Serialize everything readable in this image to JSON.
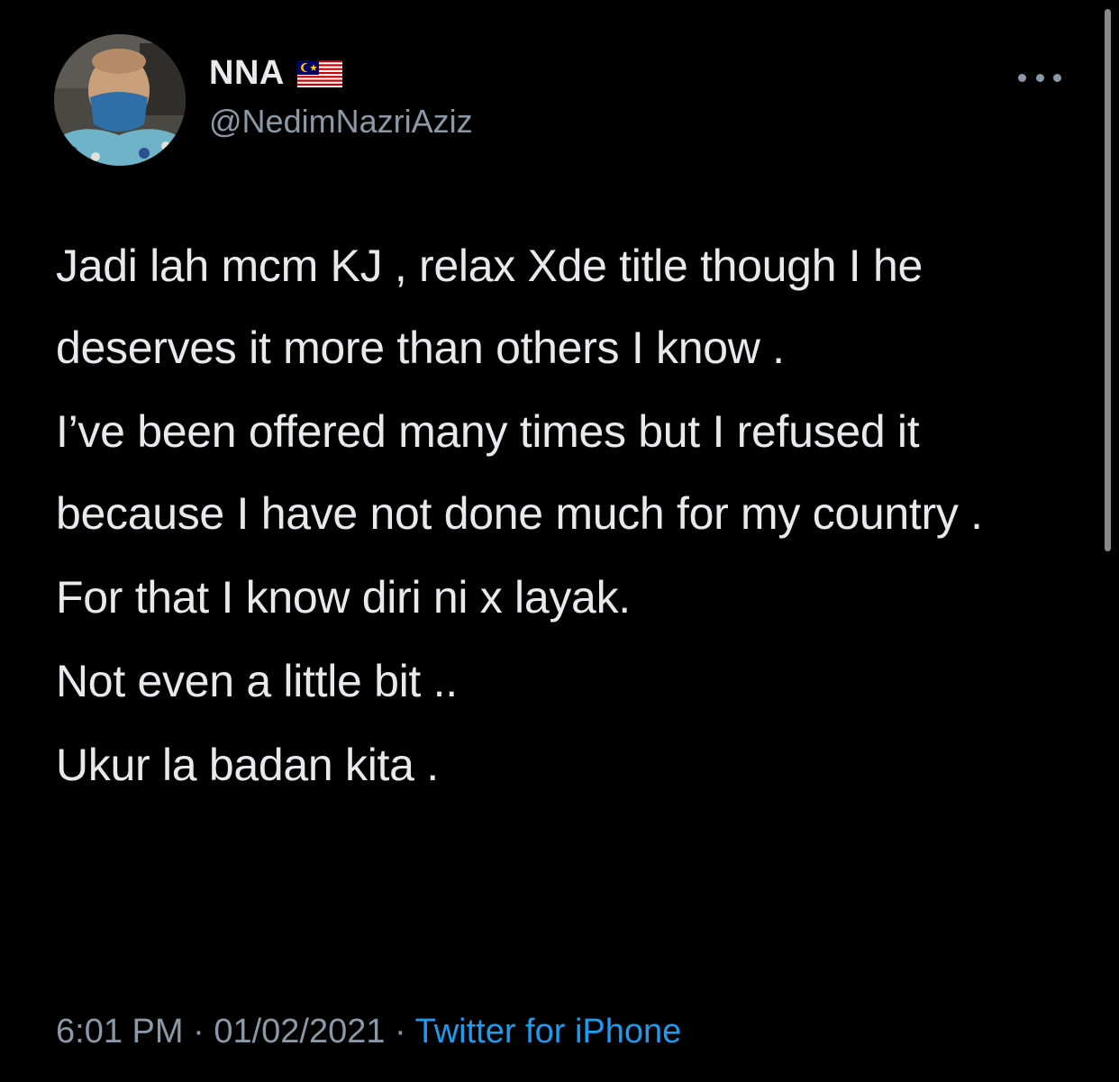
{
  "user": {
    "display_name": "NNA",
    "flag": "malaysia-flag",
    "handle": "@NedimNazriAziz"
  },
  "more_icon": "ellipsis-icon",
  "tweet": {
    "paragraphs": [
      "Jadi lah mcm KJ , relax Xde title though I he deserves it more than others I know .",
      "I’ve been offered many times but I refused it because I have not done much for my country .",
      "For that I know diri ni x layak.",
      "Not even a little bit ..",
      "Ukur la badan kita ."
    ]
  },
  "meta": {
    "time": "6:01 PM",
    "separator": " · ",
    "date": "01/02/2021",
    "source": "Twitter for iPhone"
  },
  "colors": {
    "background": "#000000",
    "text": "#e7e9ea",
    "secondary": "#8b98a5",
    "link": "#1d9bf0"
  }
}
